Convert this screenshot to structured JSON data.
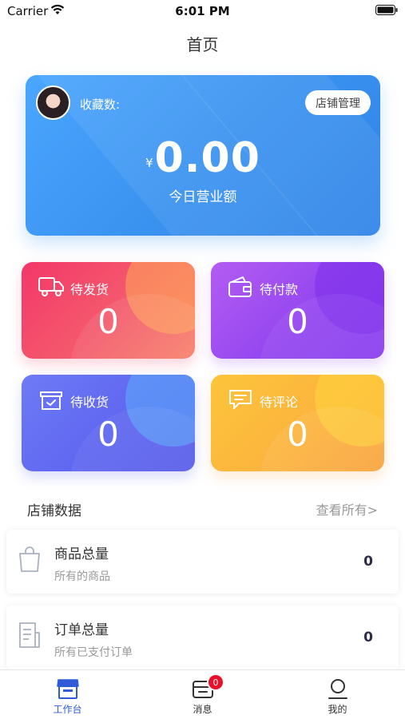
{
  "status_bar": {
    "carrier": "Carrier",
    "time": "6:01 PM"
  },
  "nav": {
    "title": "首页"
  },
  "hero": {
    "favorites_label": "收藏数:",
    "shop_manage_label": "店铺管理",
    "currency": "¥",
    "amount": "0.00",
    "amount_caption": "今日营业额"
  },
  "stats": [
    {
      "label": "待发货",
      "value": "0",
      "icon": "truck-icon"
    },
    {
      "label": "待付款",
      "value": "0",
      "icon": "wallet-icon"
    },
    {
      "label": "待收货",
      "value": "0",
      "icon": "box-icon"
    },
    {
      "label": "待评论",
      "value": "0",
      "icon": "comment-icon"
    }
  ],
  "shop_data": {
    "title": "店铺数据",
    "view_all": "查看所有>",
    "rows": [
      {
        "title": "商品总量",
        "subtitle": "所有的商品",
        "value": "0",
        "icon": "shopping-bag-icon"
      },
      {
        "title": "订单总量",
        "subtitle": "所有已支付订单",
        "value": "0",
        "icon": "order-list-icon"
      }
    ]
  },
  "tabs": [
    {
      "label": "工作台",
      "icon": "workbench-icon",
      "active": true
    },
    {
      "label": "消息",
      "icon": "message-icon",
      "badge": "0"
    },
    {
      "label": "我的",
      "icon": "user-icon"
    }
  ],
  "colors": {
    "primary": "#3b93f0",
    "tab_active": "#2f5cd6",
    "badge": "#e8102a"
  }
}
